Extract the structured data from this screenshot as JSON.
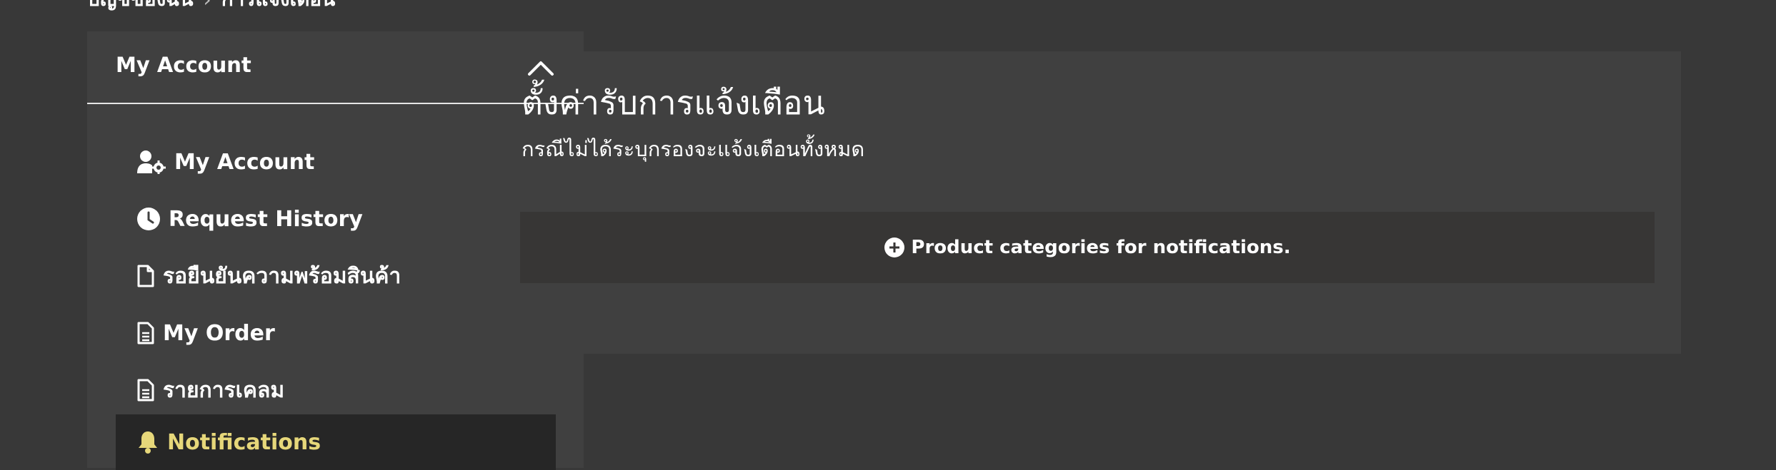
{
  "breadcrumb": {
    "parent": "บัญชีของฉัน",
    "separator": "›",
    "current": "การแจ้งเตือน"
  },
  "sidebar": {
    "title": "My Account",
    "collapse_icon": "chevron-up-icon",
    "items": [
      {
        "label": "My Account",
        "icon": "user-gear-icon",
        "active": false
      },
      {
        "label": "Request History",
        "icon": "clock-icon",
        "active": false
      },
      {
        "label": "รอยืนยันความพร้อมสินค้า",
        "icon": "file-icon",
        "active": false
      },
      {
        "label": "My Order",
        "icon": "file-lines-icon",
        "active": false
      },
      {
        "label": "รายการเคลม",
        "icon": "file-lines-icon",
        "active": false
      },
      {
        "label": "Notifications",
        "icon": "bell-icon",
        "active": true
      }
    ]
  },
  "main": {
    "title": "ตั้งค่ารับการแจ้งเตือน",
    "subtitle": "กรณีไม่ได้ระบุกรองจะแจ้งเตือนทั้งหมด",
    "add_category_label": "Product categories for notifications.",
    "add_category_icon": "plus-circle-icon"
  },
  "colors": {
    "background": "#383838",
    "panel": "#404040",
    "active_item_bg": "#262626",
    "active_item_text": "#e6d77a",
    "category_bar": "#373635"
  }
}
